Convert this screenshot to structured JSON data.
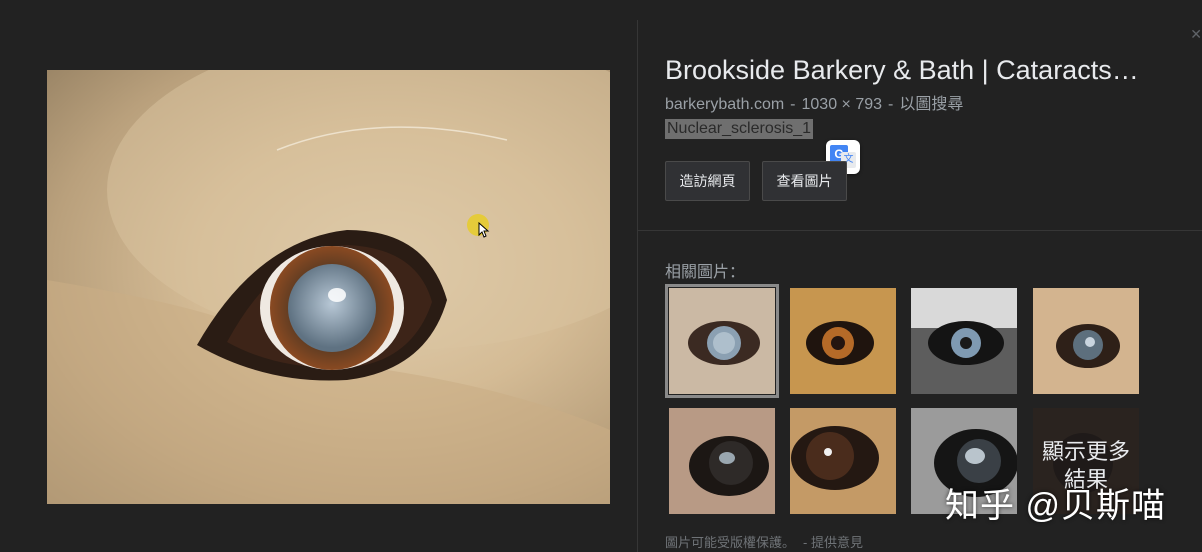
{
  "result": {
    "title": "Brookside Barkery & Bath | Cataracts…",
    "domain": "barkerybath.com",
    "dimensions": "1030 × 793",
    "search_by_image": "以圖搜尋",
    "caption": "Nuclear_sclerosis_1"
  },
  "buttons": {
    "visit_label": "造訪網頁",
    "view_label": "查看圖片"
  },
  "related": {
    "label": "相關圖片：",
    "more_label": "顯示更多結果"
  },
  "footer": {
    "copyright_note": "圖片可能受版權保護。",
    "feedback_link": "- 提供意見"
  },
  "watermark": "知乎 @贝斯喵",
  "colors": {
    "background": "#222222",
    "title_text": "#e8eaed",
    "secondary_text": "#9aa0a6"
  },
  "icons": {
    "translate": "google-translate-icon"
  }
}
